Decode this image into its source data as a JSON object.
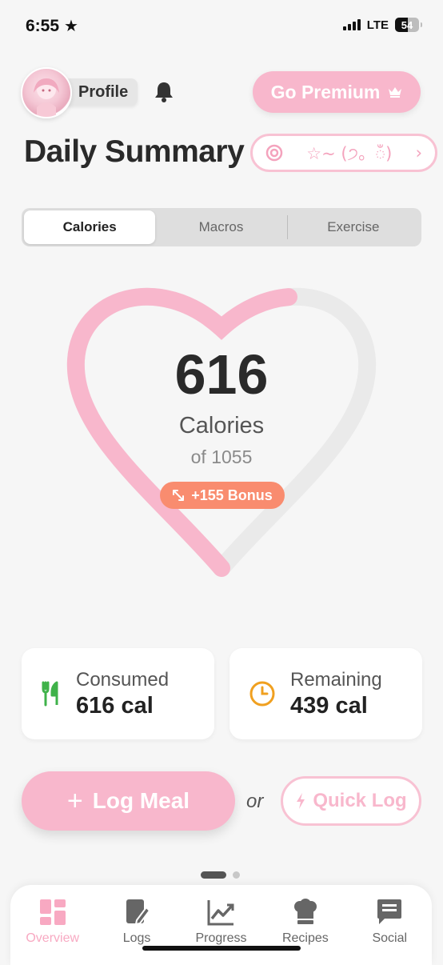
{
  "status_bar": {
    "time": "6:55",
    "network": "LTE",
    "battery": "54",
    "battery_level": 0.54
  },
  "header": {
    "profile_label": "Profile",
    "premium_label": "Go Premium",
    "title": "Daily Summary",
    "kaomoji": "☆~ (੭。ඁ)",
    "kaomoji_chevron": "›"
  },
  "tabs": [
    {
      "label": "Calories",
      "active": true
    },
    {
      "label": "Macros",
      "active": false
    },
    {
      "label": "Exercise",
      "active": false
    }
  ],
  "summary": {
    "calories": "616",
    "calories_label": "Calories",
    "goal_text": "of 1055",
    "bonus": "+155 Bonus",
    "progress": 0.584
  },
  "stats": {
    "consumed_label": "Consumed",
    "consumed_value": "616 cal",
    "remaining_label": "Remaining",
    "remaining_value": "439 cal"
  },
  "actions": {
    "log_meal": "Log Meal",
    "or": "or",
    "quick_log": "Quick Log"
  },
  "nav": [
    {
      "label": "Overview",
      "icon": "overview-icon",
      "active": true
    },
    {
      "label": "Logs",
      "icon": "logs-icon",
      "active": false
    },
    {
      "label": "Progress",
      "icon": "progress-icon",
      "active": false
    },
    {
      "label": "Recipes",
      "icon": "recipes-icon",
      "active": false
    },
    {
      "label": "Social",
      "icon": "social-icon",
      "active": false
    }
  ],
  "colors": {
    "accent_pink": "#f8b7cc",
    "bonus_orange": "#f98c6f",
    "consumed_green": "#3fb24a",
    "remaining_orange": "#f0a020",
    "track_gray": "#eaeaea"
  }
}
